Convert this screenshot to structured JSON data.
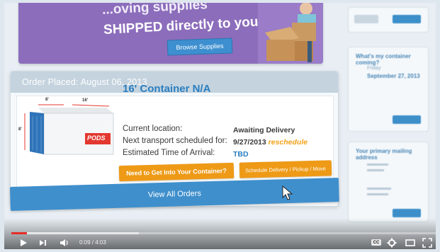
{
  "promo": {
    "line1": "...oving supplies",
    "line2": "SHIPPED directly to you?",
    "button": "Browse Supplies"
  },
  "order": {
    "placed": "Order Placed: August 06, 2013",
    "container_title": "16' Container N/A",
    "current_location_label": "Current location:",
    "current_location_value": "Awaiting Delivery",
    "next_transport_label": "Next transport scheduled for:",
    "next_transport_value": "9/27/2013",
    "reschedule": "reschedule",
    "eta_label": "Estimated Time of Arrival:",
    "eta_value": "TBD",
    "btn_get_into": "Need to Get Into Your Container?",
    "btn_schedule": "Schedule Delivery / Pickup / Move",
    "pods_logo": "PODS",
    "dim_width": "8'",
    "dim_length": "16'",
    "dim_height": "8'"
  },
  "view_all": "View All Orders",
  "right_panel": {
    "next_date_title": "What's my container coming?",
    "next_date_label": "Friday",
    "next_date_value": "September 27, 2013",
    "address_title": "Your primary mailing address"
  },
  "player": {
    "time": "0:09 / 4:03",
    "progress": 0.037,
    "cc": "CC",
    "colors": {
      "progress": "#e52d27",
      "accent": "#3f8fcc",
      "button": "#ee9a16"
    }
  }
}
